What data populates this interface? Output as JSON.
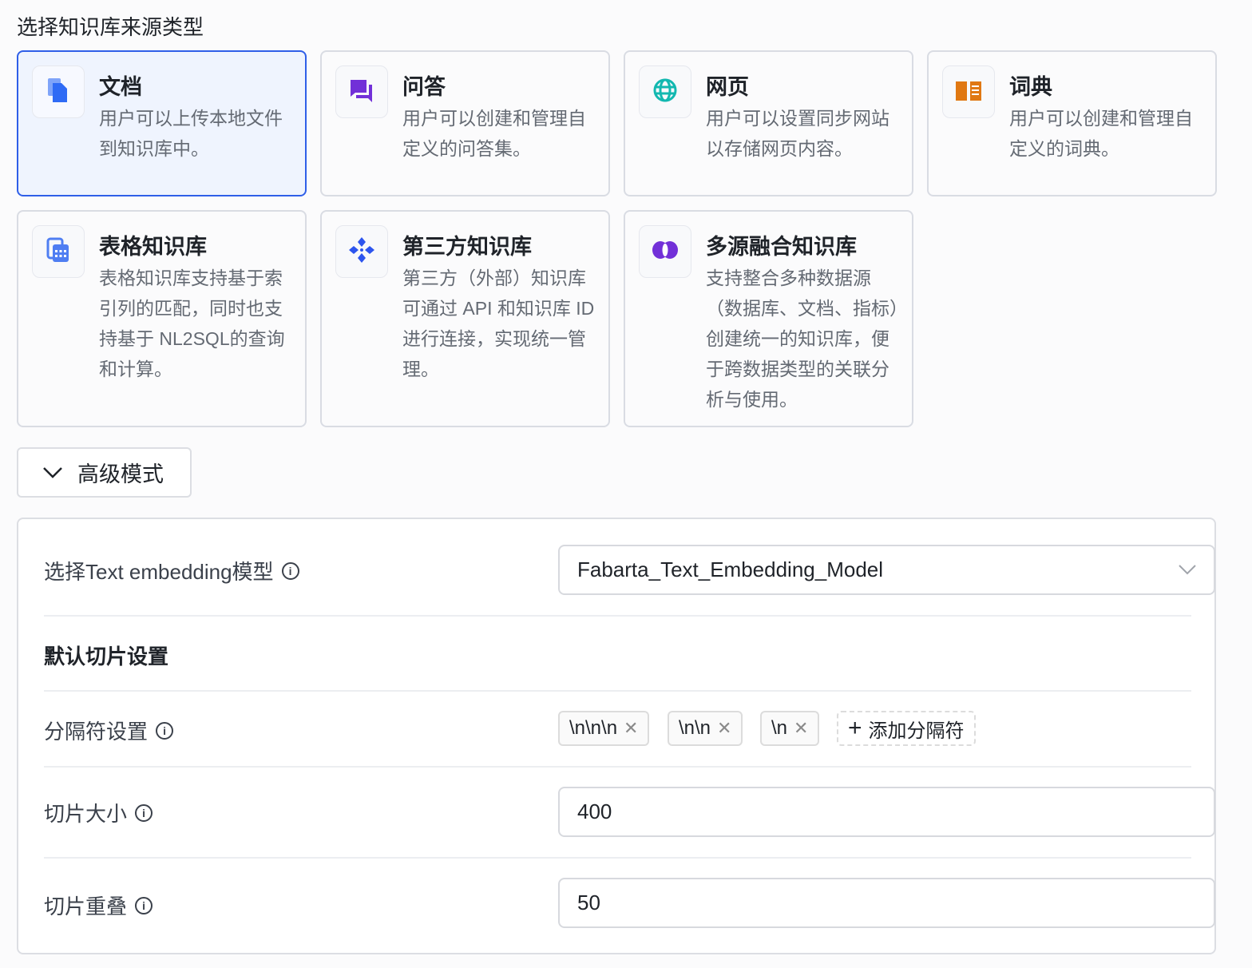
{
  "heading": "选择知识库来源类型",
  "cards": [
    {
      "title": "文档",
      "desc": "用户可以上传本地文件到知识库中。",
      "icon": "document-icon",
      "color": "#2f6bf5",
      "selected": true
    },
    {
      "title": "问答",
      "desc": "用户可以创建和管理自定义的问答集。",
      "icon": "chat-icon",
      "color": "#7230d8"
    },
    {
      "title": "网页",
      "desc": "用户可以设置同步网站以存储网页内容。",
      "icon": "globe-icon",
      "color": "#12b8b0"
    },
    {
      "title": "词典",
      "desc": "用户可以创建和管理自定义的词典。",
      "icon": "book-icon",
      "color": "#e07812"
    },
    {
      "title": "表格知识库",
      "desc": "表格知识库支持基于索引列的匹配，同时也支持基于 NL2SQL的查询和计算。",
      "icon": "table-calculator-icon",
      "color": "#4f7ef2"
    },
    {
      "title": "第三方知识库",
      "desc": "第三方（外部）知识库可通过 API 和知识库 ID 进行连接，实现统一管理。",
      "icon": "diamond-connect-icon",
      "color": "#2d55ee"
    },
    {
      "title": "多源融合知识库",
      "desc": "支持整合多种数据源（数据库、文档、指标）创建统一的知识库，便于跨数据类型的关联分析与使用。",
      "icon": "fusion-icon",
      "color": "#7230d8"
    }
  ],
  "advanced": {
    "label": "高级模式",
    "expanded": true
  },
  "settings": {
    "embedding_label": "选择Text embedding模型",
    "embedding_value": "Fabarta_Text_Embedding_Model",
    "section_title": "默认切片设置",
    "separator_label": "分隔符设置",
    "separators": [
      "\\n\\n\\n",
      "\\n\\n",
      "\\n"
    ],
    "add_separator": "添加分隔符",
    "chunk_size_label": "切片大小",
    "chunk_size": "400",
    "chunk_overlap_label": "切片重叠",
    "chunk_overlap": "50"
  }
}
